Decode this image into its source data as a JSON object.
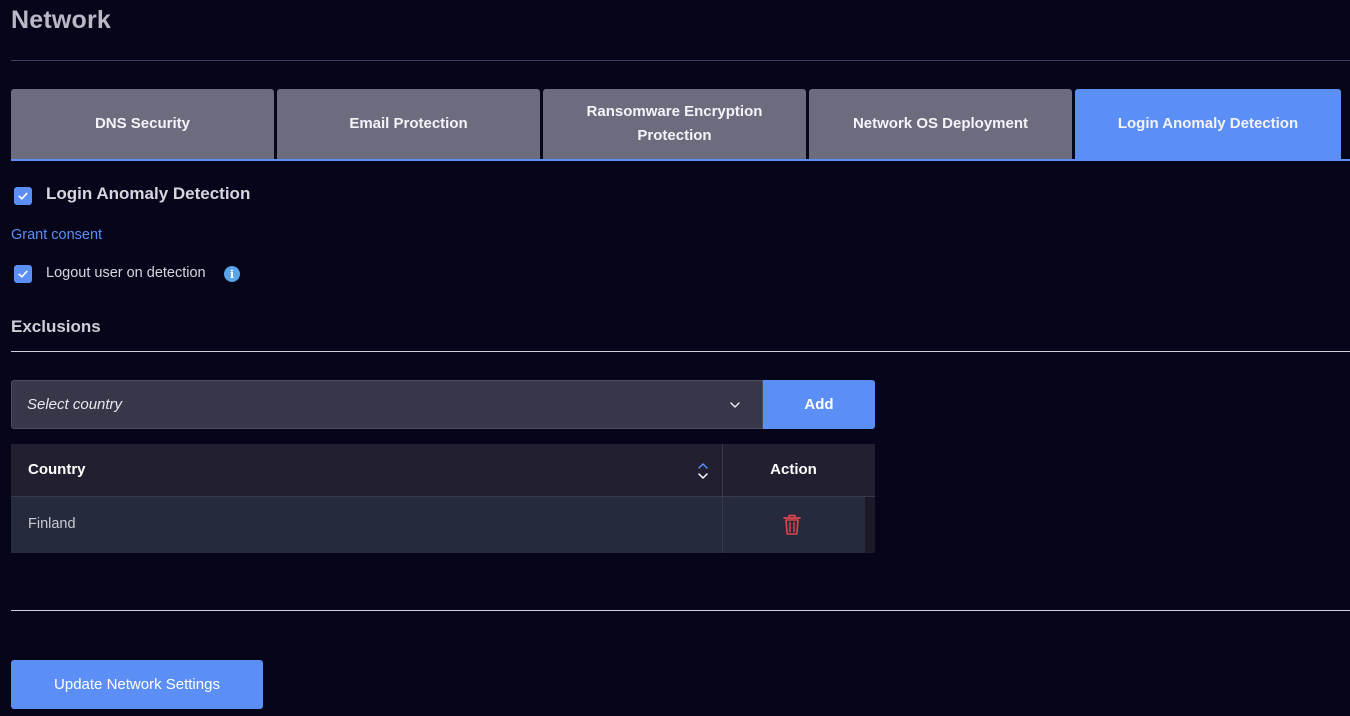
{
  "page": {
    "title": "Network"
  },
  "tabs": [
    {
      "label": "DNS Security",
      "active": false
    },
    {
      "label": "Email Protection",
      "active": false
    },
    {
      "label": "Ransomware Encryption Protection",
      "active": false
    },
    {
      "label": "Network OS Deployment",
      "active": false
    },
    {
      "label": "Login Anomaly Detection",
      "active": true
    }
  ],
  "login_anomaly": {
    "enable_label": "Login Anomaly Detection",
    "enabled": true,
    "grant_consent_label": "Grant consent",
    "logout_label": "Logout user on detection",
    "logout_enabled": true
  },
  "exclusions": {
    "heading": "Exclusions",
    "select_placeholder": "Select country",
    "add_label": "Add",
    "table": {
      "columns": [
        "Country",
        "Action"
      ],
      "rows": [
        {
          "country": "Finland"
        }
      ]
    }
  },
  "footer": {
    "update_label": "Update Network Settings"
  },
  "icons": {
    "checkbox": "check-icon",
    "info": "info-icon",
    "select": "chevron-down-icon",
    "sort": "sort-icon",
    "delete": "trash-icon"
  },
  "colors": {
    "background": "#06051a",
    "accent": "#5b8ff6",
    "tab_inactive": "#6d6c7f",
    "delete": "#e0454b"
  }
}
